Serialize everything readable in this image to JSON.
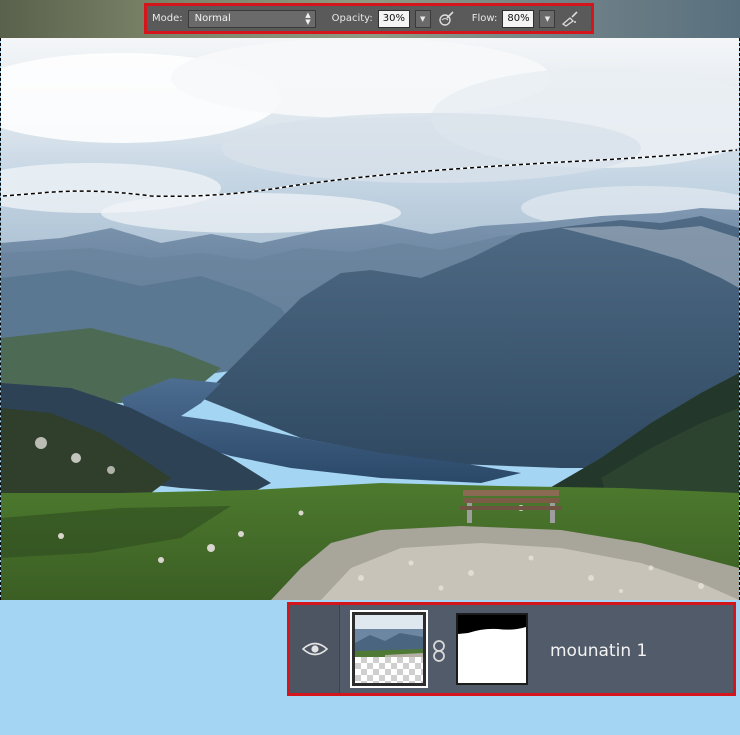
{
  "options_bar": {
    "mode_label": "Mode:",
    "mode_value": "Normal",
    "opacity_label": "Opacity:",
    "opacity_value": "30%",
    "flow_label": "Flow:",
    "flow_value": "80%",
    "highlight_color": "#d4151b",
    "icons": [
      "chevron-updown-icon",
      "triangle-down-icon",
      "pressure-opacity-icon",
      "triangle-down-icon",
      "airbrush-icon"
    ]
  },
  "canvas": {
    "selection": "marching-ants-selection-sky",
    "content": "mountain-lake-photo"
  },
  "layer": {
    "name": "mounatin 1",
    "visible": true,
    "icons": [
      "eye-icon",
      "link-icon"
    ],
    "highlight_color": "#d4151b"
  }
}
